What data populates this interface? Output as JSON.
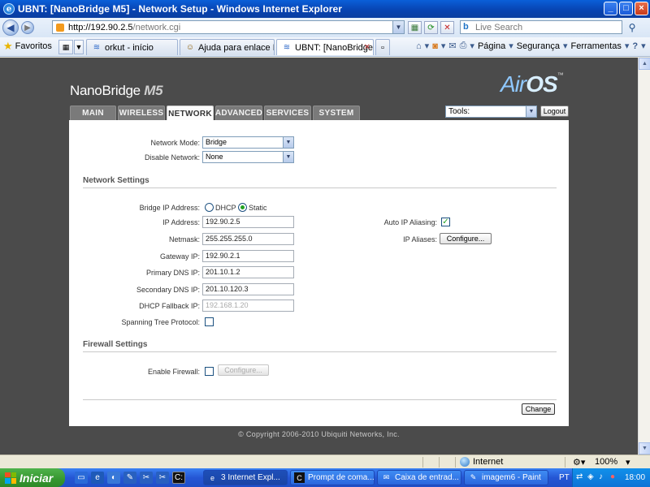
{
  "window": {
    "title": "UBNT: [NanoBridge M5] - Network Setup - Windows Internet Explorer",
    "minimize": "_",
    "maximize": "□",
    "close": "×"
  },
  "address_bar": {
    "url_host": "http://192.90.2.5",
    "url_path": "/network.cgi",
    "search_placeholder": "Live Search"
  },
  "favorites_bar": {
    "favorites_label": "Favoritos",
    "tabs": [
      {
        "label": "orkut - início"
      },
      {
        "label": "Ajuda para enlace Nan..."
      },
      {
        "label": "UBNT: [NanoBridge ..."
      }
    ],
    "commands": {
      "page": "Página",
      "safety": "Segurança",
      "tools": "Ferramentas"
    }
  },
  "airos": {
    "product_name": "NanoBridge",
    "product_model": "M5",
    "logo_air": "Air",
    "logo_os": "OS",
    "logo_tm": "™",
    "nav_tabs": [
      {
        "label": "MAIN"
      },
      {
        "label": "WIRELESS"
      },
      {
        "label": "NETWORK"
      },
      {
        "label": "ADVANCED"
      },
      {
        "label": "SERVICES"
      },
      {
        "label": "SYSTEM"
      }
    ],
    "tools_select": "Tools:",
    "logout": "Logout"
  },
  "form": {
    "network_mode_label": "Network Mode:",
    "network_mode_value": "Bridge",
    "disable_network_label": "Disable Network:",
    "disable_network_value": "None",
    "network_settings_title": "Network Settings",
    "bridge_ip_label": "Bridge IP Address:",
    "dhcp_label": "DHCP",
    "static_label": "Static",
    "ip_label": "IP Address:",
    "ip_value": "192.90.2.5",
    "netmask_label": "Netmask:",
    "netmask_value": "255.255.255.0",
    "gateway_label": "Gateway IP:",
    "gateway_value": "192.90.2.1",
    "dns1_label": "Primary DNS IP:",
    "dns1_value": "201.10.1.2",
    "dns2_label": "Secondary DNS IP:",
    "dns2_value": "201.10.120.3",
    "fallback_label": "DHCP Fallback IP:",
    "fallback_value": "192.168.1.20",
    "stp_label": "Spanning Tree Protocol:",
    "auto_alias_label": "Auto IP Aliasing:",
    "ip_aliases_label": "IP Aliases:",
    "configure_label": "Configure...",
    "firewall_settings_title": "Firewall Settings",
    "enable_firewall_label": "Enable Firewall:",
    "firewall_configure_label": "Configure...",
    "change_label": "Change"
  },
  "copyright": "© Copyright 2006-2010 Ubiquiti Networks, Inc.",
  "statusbar": {
    "zone": "Internet",
    "zoom": "100%"
  },
  "taskbar": {
    "start": "Iniciar",
    "tasks": [
      {
        "label": "3 Internet Expl..."
      },
      {
        "label": "Prompt de coma..."
      },
      {
        "label": "Caixa de entrad..."
      },
      {
        "label": "imagem6 - Paint"
      }
    ],
    "lang": "PT",
    "clock": "18:00"
  }
}
